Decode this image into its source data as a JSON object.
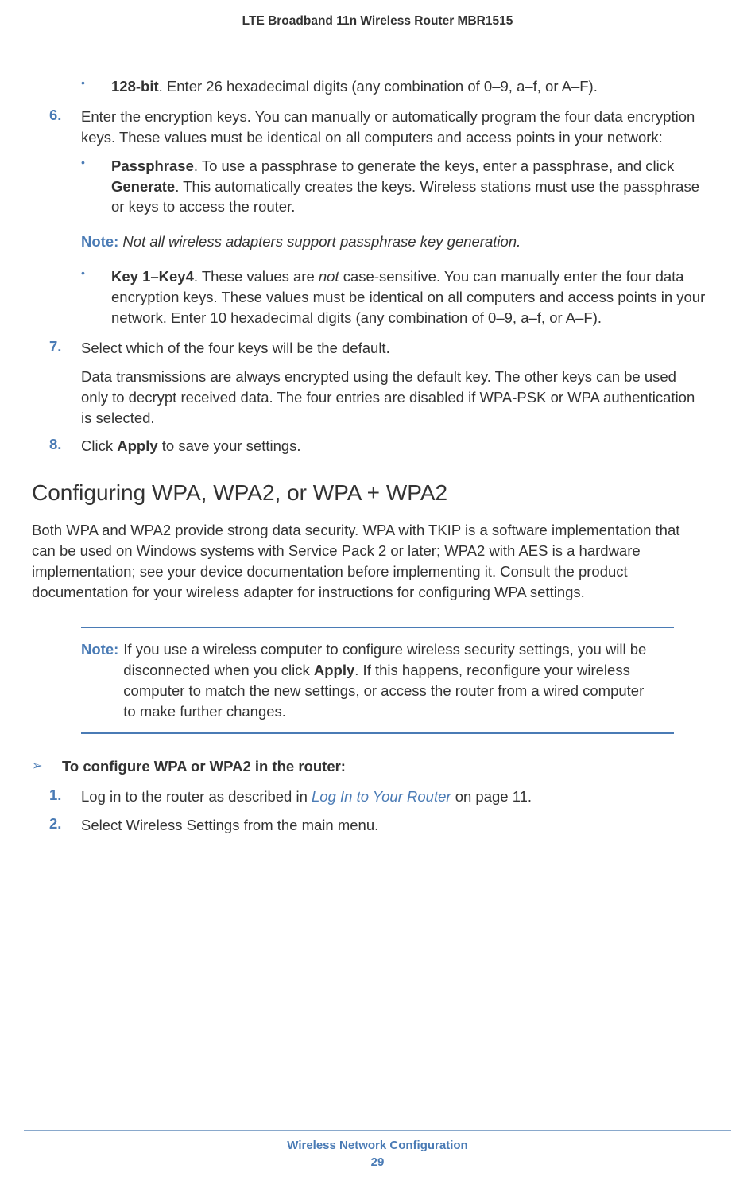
{
  "header": "LTE Broadband 11n Wireless Router MBR1515",
  "bullet1_strong": "128-bit",
  "bullet1_text": ". Enter 26 hexadecimal digits (any combination of 0–9, a–f, or A–F).",
  "step6_num": "6.",
  "step6_text": "Enter the encryption keys. You can manually or automatically program the four data encryption keys. These values must be identical on all computers and access points in your network:",
  "sub_a_strong": "Passphrase",
  "sub_a_text1": ". To use a passphrase to generate the keys, enter a passphrase, and click ",
  "sub_a_bold": "Generate",
  "sub_a_text2": ". This automatically creates the keys. Wireless stations must use the passphrase or keys to access the router.",
  "note1_label": "Note:  ",
  "note1_body": "Not all wireless adapters support passphrase key generation.",
  "sub_b_strong": "Key 1–Key4",
  "sub_b_text1": ". These values are ",
  "sub_b_italic": "not",
  "sub_b_text2": " case-sensitive. You can manually enter the four data encryption keys. These values must be identical on all computers and access points in your network. Enter 10 hexadecimal digits (any combination of 0–9, a–f, or A–F).",
  "step7_num": "7.",
  "step7_text": "Select which of the four keys will be the default.",
  "step7_para": "Data transmissions are always encrypted using the default key. The other keys can be used only to decrypt received data. The four entries are disabled if WPA-PSK or WPA authentication is selected.",
  "step8_num": "8.",
  "step8_text1": "Click ",
  "step8_bold": "Apply",
  "step8_text2": " to save your settings.",
  "section_heading": "Configuring WPA, WPA2, or WPA + WPA2",
  "section_para": "Both WPA and WPA2 provide strong data security. WPA with TKIP is a software implementation that can be used on Windows systems with Service Pack 2 or later; WPA2 with AES is a hardware implementation; see your device documentation before implementing it. Consult the product documentation for your wireless adapter for instructions for configuring WPA settings.",
  "note2_label": "Note: ",
  "note2_text1": "If you use a wireless computer to configure wireless security settings, you will be disconnected when you click ",
  "note2_bold": "Apply",
  "note2_text2": ". If this happens, reconfigure your wireless computer to match the new settings, or access the router from a wired computer to make further changes.",
  "proc_marker": "➢",
  "proc_title": "To configure WPA or WPA2 in the router:",
  "p1_num": "1.",
  "p1_text1": "Log in to the router as described in ",
  "p1_link": "Log In to Your Router",
  "p1_text2": " on page 11.",
  "p2_num": "2.",
  "p2_text": "Select Wireless Settings from the main menu.",
  "footer_title": "Wireless Network Configuration",
  "footer_page": "29",
  "bullet_glyph": "•"
}
